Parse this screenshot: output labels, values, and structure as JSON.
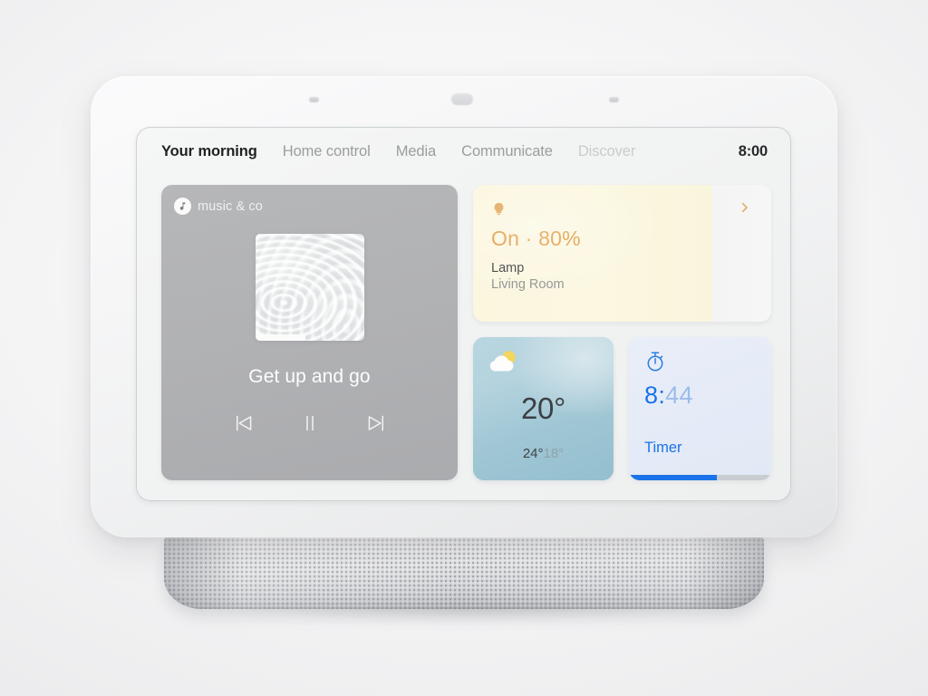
{
  "device": {
    "name": "smart-display",
    "sensors": [
      "ambient-light-sensor",
      "camera",
      "ambient-light-sensor"
    ]
  },
  "nav": {
    "items": [
      {
        "label": "Your morning",
        "state": "active"
      },
      {
        "label": "Home control",
        "state": "normal"
      },
      {
        "label": "Media",
        "state": "normal"
      },
      {
        "label": "Communicate",
        "state": "normal"
      },
      {
        "label": "Discover",
        "state": "dim"
      }
    ],
    "clock": "8:00"
  },
  "music_card": {
    "provider_name": "music & co",
    "provider_icon": "music-note-icon",
    "album_art_alt": "album-artwork",
    "track_title": "Get up and go",
    "controls": {
      "previous": "previous-track-icon",
      "playpause": "pause-icon",
      "next": "next-track-icon"
    }
  },
  "lamp_card": {
    "icon": "lightbulb-icon",
    "state": "On · 80%",
    "brightness_percent": 80,
    "name": "Lamp",
    "room": "Living Room",
    "chevron": "chevron-right-icon",
    "accent_color": "#e09436",
    "fill_color": "#fbf6de"
  },
  "weather_card": {
    "icon": "partly-cloudy-icon",
    "temperature": "20°",
    "high": "24°",
    "low": "18°"
  },
  "timer_card": {
    "icon": "stopwatch-icon",
    "minutes": "8:",
    "seconds": "44",
    "label": "Timer",
    "progress_percent": 62,
    "accent_color": "#1a73e8"
  }
}
